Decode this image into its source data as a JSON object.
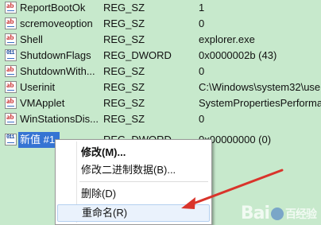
{
  "rows": [
    {
      "name": "ReportBootOk",
      "type": "REG_SZ",
      "data": "1",
      "icon": "string-value-icon"
    },
    {
      "name": "scremoveoption",
      "type": "REG_SZ",
      "data": "0",
      "icon": "string-value-icon"
    },
    {
      "name": "Shell",
      "type": "REG_SZ",
      "data": "explorer.exe",
      "icon": "string-value-icon"
    },
    {
      "name": "ShutdownFlags",
      "type": "REG_DWORD",
      "data": "0x0000002b (43)",
      "icon": "binary-value-icon"
    },
    {
      "name": "ShutdownWith...",
      "type": "REG_SZ",
      "data": "0",
      "icon": "string-value-icon"
    },
    {
      "name": "Userinit",
      "type": "REG_SZ",
      "data": "C:\\Windows\\system32\\useri",
      "icon": "string-value-icon"
    },
    {
      "name": "VMApplet",
      "type": "REG_SZ",
      "data": "SystemPropertiesPerforma",
      "icon": "string-value-icon"
    },
    {
      "name": "WinStationsDis...",
      "type": "REG_SZ",
      "data": "0",
      "icon": "string-value-icon"
    },
    {
      "name": "新值 #1",
      "type": "REG_DWORD",
      "data": "0x00000000 (0)",
      "icon": "binary-value-icon",
      "selected": true
    }
  ],
  "icon_glyphs": {
    "string": "ab",
    "binary": "011"
  },
  "context_menu": {
    "items": [
      {
        "label": "修改(M)...",
        "bold": true
      },
      {
        "label": "修改二进制数据(B)..."
      },
      {
        "label": "删除(D)"
      },
      {
        "label": "重命名(R)",
        "highlighted": true
      }
    ]
  },
  "watermark": {
    "text_left": "Bai",
    "text_right": "百经验"
  },
  "colors": {
    "background": "#c7e9cc",
    "selection": "#3574d3",
    "arrow": "#d9342b"
  }
}
